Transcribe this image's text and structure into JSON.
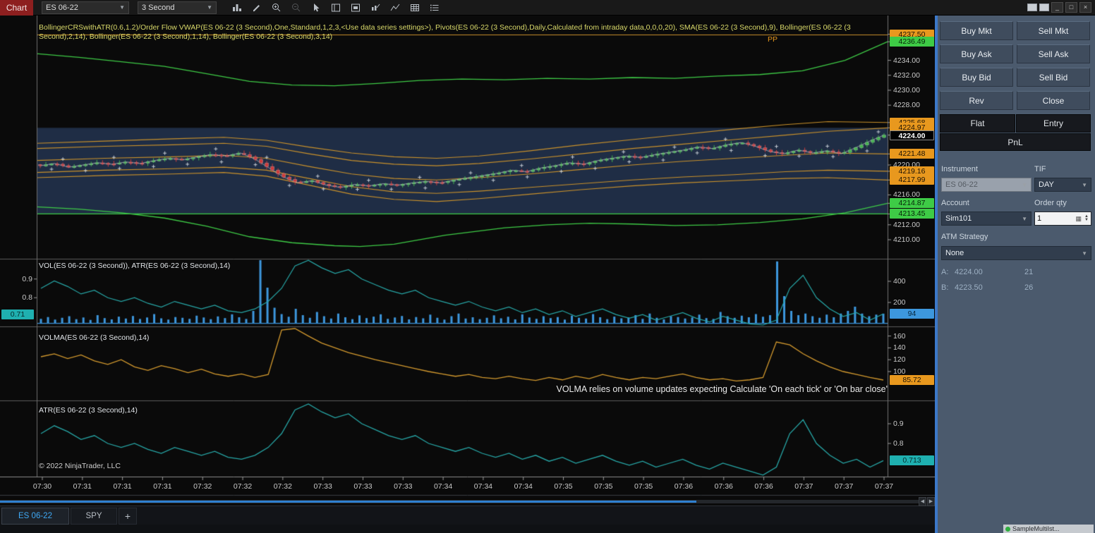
{
  "titlebar": {
    "title": "Chart",
    "instrument": "ES 06-22",
    "interval": "3 Second",
    "toolbar_icons": [
      "chart-style",
      "drawing-tools",
      "zoom-in",
      "zoom-out",
      "cursor-pointer",
      "chart-trader",
      "regions",
      "indicators",
      "trend-lines",
      "data-grid",
      "properties"
    ],
    "window_buttons": [
      {
        "name": "instrument-link",
        "glyph": ""
      },
      {
        "name": "interval-link",
        "glyph": ""
      },
      {
        "name": "minimize",
        "glyph": "_"
      },
      {
        "name": "maximize",
        "glyph": "□"
      },
      {
        "name": "close",
        "glyph": "×"
      }
    ]
  },
  "chart": {
    "indicator_label": "BollingerCRSwithATR(0.6,1.2)/Order Flow VWAP(ES 06-22 (3 Second),One,Standard,1,2,3,<Use data series settings>), Pivots(ES 06-22 (3 Second),Daily,Calculated from intraday data,0,0,0,20), SMA(ES 06-22 (3 Second),9), Bollinger(ES 06-22 (3 Second),2,14), Bollinger(ES 06-22 (3 Second),1,14), Bollinger(ES 06-22 (3 Second),3,14)",
    "pivot_label": "PP",
    "vol_panel_label": "VOL(ES 06-22 (3 Second)), ATR(ES 06-22 (3 Second),14)",
    "volma_panel_label": "VOLMA(ES 06-22 (3 Second),14)",
    "atr_panel_label": "ATR(ES 06-22 (3 Second),14)",
    "volma_warning": "VOLMA relies on volume updates expecting Calculate 'On each tick' or 'On bar close'",
    "copyright": "© 2022 NinjaTrader, LLC"
  },
  "chart_data": {
    "type": "candlestick",
    "time_labels": [
      "07:30",
      "07:31",
      "07:31",
      "07:31",
      "07:32",
      "07:32",
      "07:32",
      "07:33",
      "07:33",
      "07:33",
      "07:34",
      "07:34",
      "07:34",
      "07:35",
      "07:35",
      "07:35",
      "07:36",
      "07:36",
      "07:36",
      "07:37",
      "07:37",
      "07:37"
    ],
    "price_axis": {
      "visible_range": [
        4207.5,
        4240.0
      ],
      "plain": [
        {
          "label": "4234.00",
          "value": 4234
        },
        {
          "label": "4232.00",
          "value": 4232
        },
        {
          "label": "4230.00",
          "value": 4230
        },
        {
          "label": "4228.00",
          "value": 4228
        },
        {
          "label": "4220.00",
          "value": 4220
        },
        {
          "label": "4216.00",
          "value": 4216
        },
        {
          "label": "4212.00",
          "value": 4212
        },
        {
          "label": "4210.00",
          "value": 4210
        }
      ],
      "tags": [
        {
          "label": "4237.50",
          "value": 4237.5,
          "color": "orange"
        },
        {
          "label": "4236.49",
          "value": 4236.49,
          "color": "green"
        },
        {
          "label": "4225.68",
          "value": 4225.68,
          "color": "orange"
        },
        {
          "label": "4224.97",
          "value": 4224.97,
          "color": "orange"
        },
        {
          "label": "4224.00",
          "value": 4224.0,
          "color": "black"
        },
        {
          "label": "4221.48",
          "value": 4221.48,
          "color": "orange"
        },
        {
          "label": "4219.16",
          "value": 4219.16,
          "color": "orange"
        },
        {
          "label": "4217.99",
          "value": 4217.99,
          "color": "orange"
        },
        {
          "label": "4214.87",
          "value": 4214.87,
          "color": "green"
        },
        {
          "label": "4213.45",
          "value": 4213.45,
          "color": "green"
        }
      ]
    },
    "close_path": [
      4219.9,
      4220.2,
      4219.7,
      4220.0,
      4220.3,
      4220.1,
      4220.4,
      4220.2,
      4220.6,
      4220.9,
      4220.7,
      4221.1,
      4221.4,
      4221.2,
      4221.6,
      4220.8,
      4219.6,
      4218.4,
      4217.6,
      4217.9,
      4217.3,
      4217.0,
      4217.4,
      4217.2,
      4217.5,
      4217.3,
      4217.6,
      4217.8,
      4217.6,
      4218.0,
      4218.3,
      4218.6,
      4218.9,
      4219.3,
      4219.1,
      4219.6,
      4219.9,
      4220.3,
      4220.1,
      4220.6,
      4220.9,
      4221.2,
      4221.0,
      4221.4,
      4221.7,
      4222.0,
      4222.4,
      4222.2,
      4222.7,
      4223.0,
      4222.5,
      4221.8,
      4221.5,
      4222.0,
      4221.6,
      4221.9,
      4221.5,
      4222.3,
      4223.2,
      4224.0
    ],
    "bands": {
      "pivot_pp": 4237.4,
      "green_hline": 4213.45,
      "shaded_region": [
        4224.97,
        4213.45
      ],
      "green_upper": [
        [
          0,
          4234.9
        ],
        [
          0.05,
          4234.4
        ],
        [
          0.1,
          4233.8
        ],
        [
          0.15,
          4233.2
        ],
        [
          0.2,
          4232.2
        ],
        [
          0.25,
          4231.2
        ],
        [
          0.3,
          4230.7
        ],
        [
          0.35,
          4230.6
        ],
        [
          0.4,
          4230.9
        ],
        [
          0.45,
          4231.3
        ],
        [
          0.5,
          4231.5
        ],
        [
          0.55,
          4231.4
        ],
        [
          0.6,
          4231.6
        ],
        [
          0.65,
          4231.5
        ],
        [
          0.7,
          4231.7
        ],
        [
          0.75,
          4231.6
        ],
        [
          0.8,
          4231.9
        ],
        [
          0.85,
          4232.1
        ],
        [
          0.9,
          4232.6
        ],
        [
          0.95,
          4234.0
        ],
        [
          1,
          4236.49
        ]
      ],
      "green_lower": [
        [
          0,
          4214.4
        ],
        [
          0.05,
          4214.1
        ],
        [
          0.1,
          4213.6
        ],
        [
          0.15,
          4212.9
        ],
        [
          0.2,
          4211.8
        ],
        [
          0.25,
          4210.4
        ],
        [
          0.3,
          4209.6
        ],
        [
          0.35,
          4209.2
        ],
        [
          0.38,
          4209.1
        ],
        [
          0.42,
          4209.4
        ],
        [
          0.48,
          4210.6
        ],
        [
          0.55,
          4211.6
        ],
        [
          0.6,
          4212.0
        ],
        [
          0.65,
          4212.2
        ],
        [
          0.7,
          4212.1
        ],
        [
          0.75,
          4211.9
        ],
        [
          0.8,
          4212.0
        ],
        [
          0.85,
          4212.3
        ],
        [
          0.9,
          4212.8
        ],
        [
          0.95,
          4213.6
        ],
        [
          1,
          4214.87
        ]
      ],
      "orange_up2": [
        [
          0,
          4222.9
        ],
        [
          0.08,
          4223.2
        ],
        [
          0.16,
          4223.5
        ],
        [
          0.22,
          4223.7
        ],
        [
          0.27,
          4223.3
        ],
        [
          0.32,
          4222.4
        ],
        [
          0.37,
          4221.6
        ],
        [
          0.42,
          4221.1
        ],
        [
          0.47,
          4220.9
        ],
        [
          0.52,
          4221.2
        ],
        [
          0.58,
          4221.9
        ],
        [
          0.64,
          4222.7
        ],
        [
          0.7,
          4223.4
        ],
        [
          0.76,
          4224.1
        ],
        [
          0.82,
          4224.8
        ],
        [
          0.88,
          4225.4
        ],
        [
          0.93,
          4225.8
        ],
        [
          1,
          4225.68
        ]
      ],
      "orange_up1": [
        [
          0,
          4222.2
        ],
        [
          0.08,
          4222.5
        ],
        [
          0.16,
          4222.7
        ],
        [
          0.22,
          4222.9
        ],
        [
          0.27,
          4222.5
        ],
        [
          0.32,
          4221.5
        ],
        [
          0.37,
          4220.6
        ],
        [
          0.42,
          4220.1
        ],
        [
          0.47,
          4219.9
        ],
        [
          0.52,
          4220.2
        ],
        [
          0.58,
          4220.8
        ],
        [
          0.64,
          4221.5
        ],
        [
          0.7,
          4222.2
        ],
        [
          0.76,
          4222.8
        ],
        [
          0.82,
          4223.4
        ],
        [
          0.88,
          4224.0
        ],
        [
          0.93,
          4224.5
        ],
        [
          1,
          4224.97
        ]
      ],
      "orange_mid": [
        [
          0,
          4220.6
        ],
        [
          0.08,
          4220.9
        ],
        [
          0.16,
          4221.1
        ],
        [
          0.22,
          4221.3
        ],
        [
          0.27,
          4220.9
        ],
        [
          0.32,
          4219.8
        ],
        [
          0.37,
          4218.8
        ],
        [
          0.42,
          4218.2
        ],
        [
          0.47,
          4218.0
        ],
        [
          0.52,
          4218.3
        ],
        [
          0.58,
          4218.8
        ],
        [
          0.64,
          4219.4
        ],
        [
          0.7,
          4220.0
        ],
        [
          0.76,
          4220.5
        ],
        [
          0.82,
          4220.9
        ],
        [
          0.88,
          4221.3
        ],
        [
          0.93,
          4221.6
        ],
        [
          1,
          4221.48
        ]
      ],
      "orange_dn1": [
        [
          0,
          4219.0
        ],
        [
          0.08,
          4219.3
        ],
        [
          0.16,
          4219.5
        ],
        [
          0.22,
          4219.7
        ],
        [
          0.27,
          4219.3
        ],
        [
          0.32,
          4218.2
        ],
        [
          0.37,
          4217.1
        ],
        [
          0.42,
          4216.4
        ],
        [
          0.47,
          4216.2
        ],
        [
          0.52,
          4216.5
        ],
        [
          0.58,
          4217.0
        ],
        [
          0.64,
          4217.5
        ],
        [
          0.7,
          4218.0
        ],
        [
          0.76,
          4218.4
        ],
        [
          0.82,
          4218.7
        ],
        [
          0.88,
          4219.1
        ],
        [
          0.93,
          4219.3
        ],
        [
          1,
          4219.16
        ]
      ],
      "orange_dn2": [
        [
          0,
          4218.3
        ],
        [
          0.08,
          4218.6
        ],
        [
          0.16,
          4218.8
        ],
        [
          0.22,
          4219.0
        ],
        [
          0.27,
          4218.5
        ],
        [
          0.32,
          4217.3
        ],
        [
          0.37,
          4216.1
        ],
        [
          0.42,
          4215.4
        ],
        [
          0.47,
          4215.1
        ],
        [
          0.52,
          4215.5
        ],
        [
          0.58,
          4216.1
        ],
        [
          0.64,
          4216.7
        ],
        [
          0.7,
          4217.2
        ],
        [
          0.76,
          4217.6
        ],
        [
          0.82,
          4217.9
        ],
        [
          0.88,
          4218.2
        ],
        [
          0.93,
          4218.3
        ],
        [
          1,
          4217.99
        ]
      ]
    },
    "volume": {
      "values": [
        45,
        62,
        38,
        55,
        70,
        42,
        58,
        35,
        80,
        52,
        40,
        66,
        48,
        72,
        44,
        58,
        90,
        50,
        38,
        62,
        55,
        45,
        75,
        58,
        42,
        68,
        52,
        88,
        60,
        44,
        120,
        600,
        340,
        150,
        90,
        65,
        140,
        80,
        55,
        110,
        70,
        48,
        95,
        60,
        42,
        78,
        52,
        66,
        88,
        45,
        58,
        72,
        40,
        62,
        50,
        85,
        55,
        38,
        70,
        95,
        48,
        60,
        42,
        55,
        78,
        50,
        65,
        40,
        88,
        58,
        45,
        70,
        52,
        62,
        38,
        75,
        55,
        48,
        90,
        60,
        42,
        66,
        50,
        58,
        80,
        45,
        95,
        55,
        40,
        70,
        62,
        48,
        58,
        85,
        52,
        44,
        110,
        70,
        55,
        75,
        60,
        90,
        65,
        80,
        588,
        260,
        120,
        80,
        95,
        70,
        55,
        85,
        60,
        95,
        120,
        160,
        95,
        70,
        85,
        94
      ],
      "axis": [
        {
          "label": "400",
          "value": 400
        },
        {
          "label": "200",
          "value": 200
        }
      ],
      "tag": {
        "label": "94",
        "value": 94,
        "color": "blue"
      }
    },
    "atr": {
      "values": [
        0.85,
        0.89,
        0.86,
        0.82,
        0.84,
        0.8,
        0.78,
        0.8,
        0.77,
        0.75,
        0.78,
        0.76,
        0.74,
        0.76,
        0.73,
        0.72,
        0.74,
        0.78,
        0.85,
        0.97,
        1.0,
        0.96,
        0.93,
        0.95,
        0.9,
        0.87,
        0.84,
        0.82,
        0.84,
        0.8,
        0.78,
        0.76,
        0.78,
        0.75,
        0.73,
        0.75,
        0.72,
        0.74,
        0.71,
        0.73,
        0.7,
        0.72,
        0.74,
        0.71,
        0.69,
        0.71,
        0.68,
        0.7,
        0.72,
        0.69,
        0.67,
        0.7,
        0.68,
        0.66,
        0.64,
        0.68,
        0.85,
        0.92,
        0.8,
        0.74,
        0.7,
        0.72,
        0.68,
        0.713
      ],
      "left_axis": [
        {
          "label": "0.9",
          "value": 0.9
        },
        {
          "label": "0.8",
          "value": 0.8
        }
      ],
      "left_tag": {
        "label": "0.71",
        "value": 0.71,
        "color": "teal"
      },
      "panel_axis": [
        {
          "label": "0.9",
          "value": 0.9
        },
        {
          "label": "0.8",
          "value": 0.8
        }
      ],
      "panel_tag": {
        "label": "0.713",
        "value": 0.713,
        "color": "teal"
      }
    },
    "volma": {
      "values": [
        125,
        130,
        122,
        128,
        118,
        112,
        120,
        108,
        102,
        110,
        105,
        98,
        104,
        96,
        92,
        96,
        90,
        95,
        170,
        175,
        160,
        148,
        140,
        132,
        126,
        120,
        115,
        110,
        105,
        100,
        96,
        92,
        95,
        90,
        88,
        92,
        88,
        85,
        90,
        86,
        92,
        88,
        95,
        90,
        86,
        90,
        88,
        92,
        96,
        90,
        86,
        88,
        84,
        86,
        90,
        150,
        145,
        130,
        118,
        108,
        100,
        95,
        90,
        85.72
      ],
      "axis": [
        {
          "label": "160",
          "value": 160
        },
        {
          "label": "140",
          "value": 140
        },
        {
          "label": "120",
          "value": 120
        },
        {
          "label": "100",
          "value": 100
        }
      ],
      "tag": {
        "label": "85.72",
        "value": 85.72,
        "color": "orange"
      }
    }
  },
  "order_panel": {
    "buttons": [
      {
        "label": "Buy Mkt"
      },
      {
        "label": "Sell Mkt"
      },
      {
        "label": "Buy Ask"
      },
      {
        "label": "Sell Ask"
      },
      {
        "label": "Buy Bid"
      },
      {
        "label": "Sell Bid"
      },
      {
        "label": "Rev"
      },
      {
        "label": "Close"
      }
    ],
    "flat_label": "Flat",
    "entry_label": "Entry",
    "pnl_label": "PnL",
    "instrument_label": "Instrument",
    "tif_label": "TIF",
    "instrument_value": "ES 06-22",
    "tif_value": "DAY",
    "account_label": "Account",
    "qty_label": "Order qty",
    "account_value": "Sim101",
    "qty_value": "1",
    "atm_label": "ATM Strategy",
    "atm_value": "None",
    "ask_label": "A:",
    "ask_price": "4224.00",
    "ask_size": "21",
    "bid_label": "B:",
    "bid_price": "4223.50",
    "bid_size": "26"
  },
  "tabs": {
    "items": [
      {
        "label": "ES 06-22",
        "active": true
      },
      {
        "label": "SPY",
        "active": false
      }
    ],
    "add_label": "+"
  },
  "strategy_tab": {
    "label": "SampleMultiIst..."
  },
  "colors": {
    "up": "#43b64c",
    "down": "#cf3a3a",
    "volume": "#3d97dd",
    "atr": "#27a7a7",
    "volma": "#d49a2e",
    "band_green": "#3ecb46",
    "band_orange": "#c9912b",
    "tag_orange": "#e8981e",
    "tag_green": "#3ecb46",
    "tag_blue": "#3d97dd",
    "tag_teal": "#1fb0b0",
    "region_blue": "rgba(62,96,153,0.42)",
    "splitter": "#3c78c8"
  }
}
